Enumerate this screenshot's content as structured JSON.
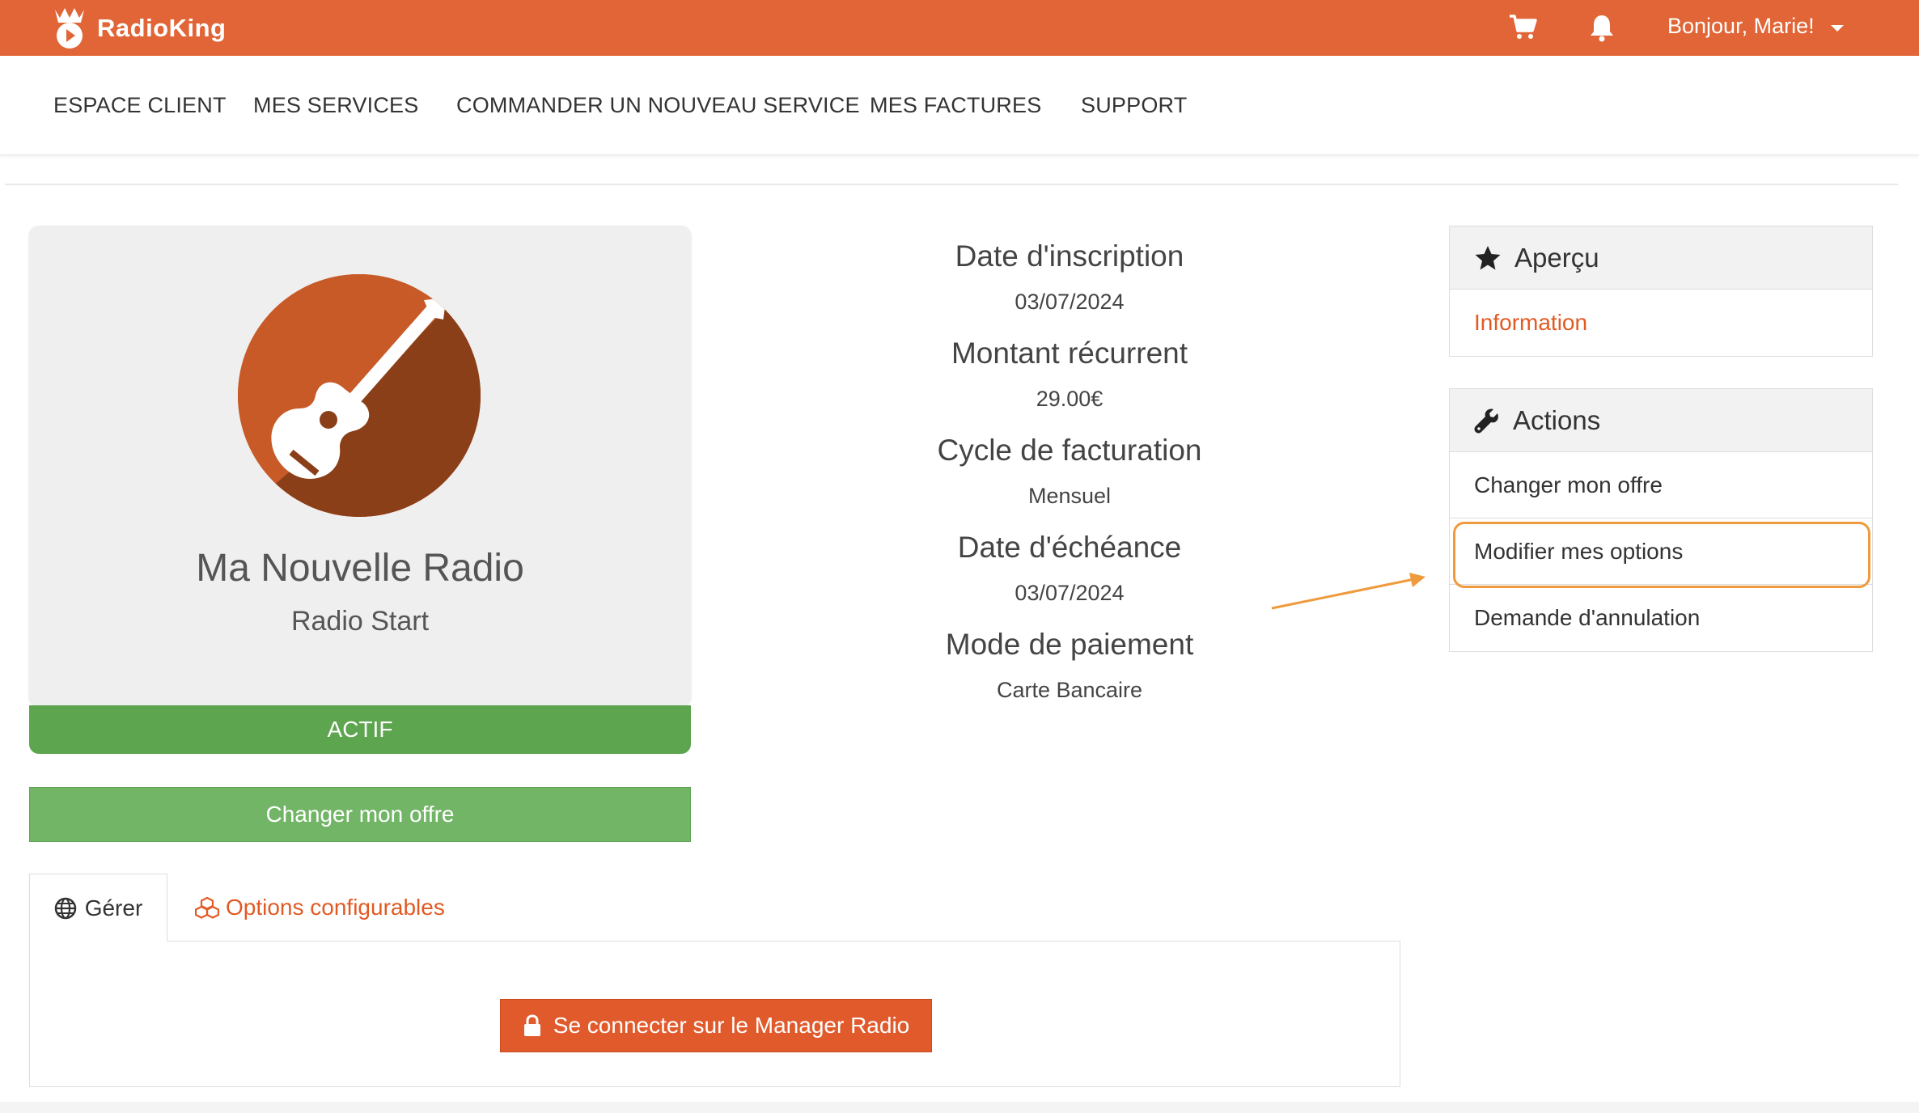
{
  "header": {
    "brand": "RadioKing",
    "greeting": "Bonjour, Marie!",
    "cart_icon": "cart-icon",
    "bell_icon": "bell-icon",
    "bar_color": "#e16536"
  },
  "nav": {
    "items": [
      "ESPACE CLIENT",
      "MES SERVICES",
      "COMMANDER UN NOUVEAU SERVICE",
      "MES FACTURES",
      "SUPPORT"
    ]
  },
  "product": {
    "name": "Ma Nouvelle Radio",
    "plan": "Radio Start",
    "status": "ACTIF",
    "change_button": "Changer mon offre",
    "icon": "guitar-icon"
  },
  "info": [
    {
      "label": "Date d'inscription",
      "value": "03/07/2024"
    },
    {
      "label": "Montant récurrent",
      "value": "29.00€"
    },
    {
      "label": "Cycle de facturation",
      "value": "Mensuel"
    },
    {
      "label": "Date d'échéance",
      "value": "03/07/2024"
    },
    {
      "label": "Mode de paiement",
      "value": "Carte Bancaire"
    }
  ],
  "overview": {
    "title": "Aperçu",
    "items": [
      "Information"
    ]
  },
  "actions": {
    "title": "Actions",
    "items": [
      "Changer mon offre",
      "Modifier mes options",
      "Demande d'annulation"
    ]
  },
  "tabs": {
    "manage": "Gérer",
    "options": "Options configurables",
    "connect_button": "Se connecter sur le Manager Radio"
  },
  "colors": {
    "accent": "#e15a24",
    "active": "#5ea550",
    "highlight": "#ef9a3c"
  }
}
